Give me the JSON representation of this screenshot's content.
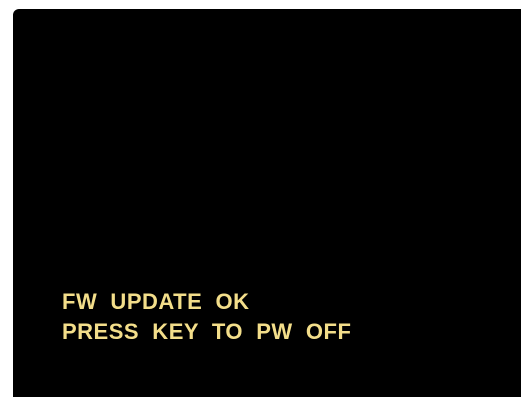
{
  "screen": {
    "background_color": "#000000",
    "text_color": "#f3de8a",
    "lines": [
      "FW  UPDATE  OK",
      "PRESS  KEY  TO  PW  OFF"
    ]
  }
}
